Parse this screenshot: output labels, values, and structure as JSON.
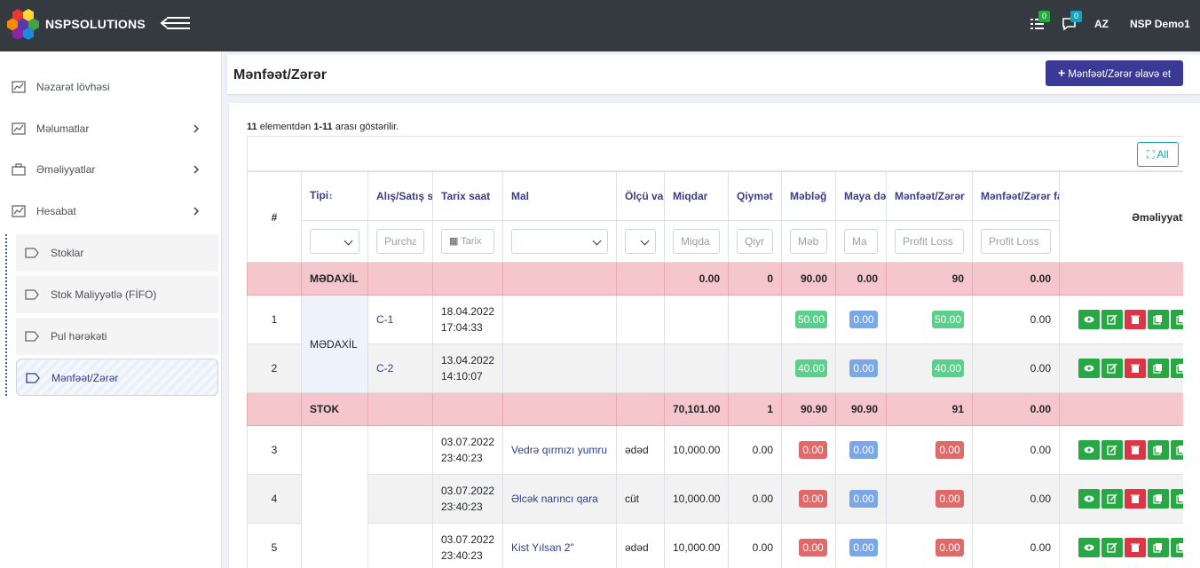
{
  "brand": {
    "name": "NSPSOLUTIONS"
  },
  "navbar": {
    "tasks_badge": "0",
    "messages_badge": "0",
    "language": "AZ",
    "user": "NSP Demo1",
    "badge_colors": {
      "tasks": "#28a745",
      "messages": "#17a2b8"
    }
  },
  "sidebar": {
    "items": [
      {
        "label": "Nəzarət lövhəsi",
        "icon": "chart-icon",
        "chevron": false
      },
      {
        "label": "Məlumatlar",
        "icon": "chart-icon",
        "chevron": true
      },
      {
        "label": "Əməliyyatlar",
        "icon": "briefcase-icon",
        "chevron": true
      },
      {
        "label": "Hesabat",
        "icon": "chart-icon",
        "chevron": true
      }
    ],
    "subitems": [
      {
        "label": "Stoklar",
        "active": false
      },
      {
        "label": "Stok Maliyyətlə (FİFO)",
        "active": false
      },
      {
        "label": "Pul hərəkəti",
        "active": false
      },
      {
        "label": "Mənfəət/Zərər",
        "active": true
      }
    ]
  },
  "page": {
    "title": "Mənfəət/Zərər",
    "add_button": "Mənfəət/Zərər əlavə et",
    "accent": "#3a3996"
  },
  "summary": {
    "total": "11",
    "range": "1-11",
    "text_a": " elementdən ",
    "text_b": " arası göstərilir."
  },
  "toolbar": {
    "all_button": "All"
  },
  "table": {
    "headers": {
      "hash": "#",
      "type": "Tipi",
      "doc_no": "Alış/Satış sənəd no",
      "date": "Tarix saat",
      "item": "Mal",
      "unit": "Ölçü vahidi",
      "qty": "Miqdar",
      "price": "Qiymət",
      "amount": "Məbləğ",
      "cost": "Maya dəyəri",
      "profit": "Mənfəət/Zərər",
      "profit_pct": "Mənfəət/Zərər faizi",
      "ops": "Əməliyyatlar"
    },
    "filters": {
      "doc_no": "Purcha",
      "date": "Tarix",
      "qty": "Miqda",
      "price": "Qiyr",
      "amount": "Məb",
      "cost": "Ma",
      "profit": "Profit Loss",
      "profit_pct": "Profit Loss"
    },
    "groups": [
      {
        "name": "MƏDAXİL",
        "qty": "0.00",
        "price": "0",
        "amount": "90.00",
        "cost": "0.00",
        "profit": "90",
        "profit_pct": "0.00",
        "rows": [
          {
            "idx": "1",
            "doc": "C-1",
            "date": "18.04.2022",
            "time": "17:04:33",
            "item": "",
            "unit": "",
            "qty": "",
            "price": "",
            "amount": "50.00",
            "cost": "0.00",
            "profit": "50.00",
            "profit_pct": "0.00",
            "tone": "green"
          },
          {
            "idx": "2",
            "doc": "C-2",
            "date": "13.04.2022",
            "time": "14:10:07",
            "item": "",
            "unit": "",
            "qty": "",
            "price": "",
            "amount": "40.00",
            "cost": "0.00",
            "profit": "40.00",
            "profit_pct": "0.00",
            "tone": "green"
          }
        ]
      },
      {
        "name": "STOK",
        "qty": "70,101.00",
        "price": "1",
        "amount": "90.90",
        "cost": "90.90",
        "profit": "91",
        "profit_pct": "0.00",
        "rows": [
          {
            "idx": "3",
            "doc": "",
            "date": "03.07.2022",
            "time": "23:40:23",
            "item": "Vedrə qırmızı yumru",
            "unit": "ədəd",
            "qty": "10,000.00",
            "price": "0.00",
            "amount": "0.00",
            "cost": "0.00",
            "profit": "0.00",
            "profit_pct": "0.00",
            "tone": "red"
          },
          {
            "idx": "4",
            "doc": "",
            "date": "03.07.2022",
            "time": "23:40:23",
            "item": "Əlcək narıncı qara",
            "unit": "cüt",
            "qty": "10,000.00",
            "price": "0.00",
            "amount": "0.00",
            "cost": "0.00",
            "profit": "0.00",
            "profit_pct": "0.00",
            "tone": "red"
          },
          {
            "idx": "5",
            "doc": "",
            "date": "03.07.2022",
            "time": "23:40:23",
            "item": "Kist Yılsan 2\"",
            "unit": "ədəd",
            "qty": "10,000.00",
            "price": "0.00",
            "amount": "0.00",
            "cost": "0.00",
            "profit": "0.00",
            "profit_pct": "0.00",
            "tone": "red"
          }
        ]
      }
    ]
  }
}
